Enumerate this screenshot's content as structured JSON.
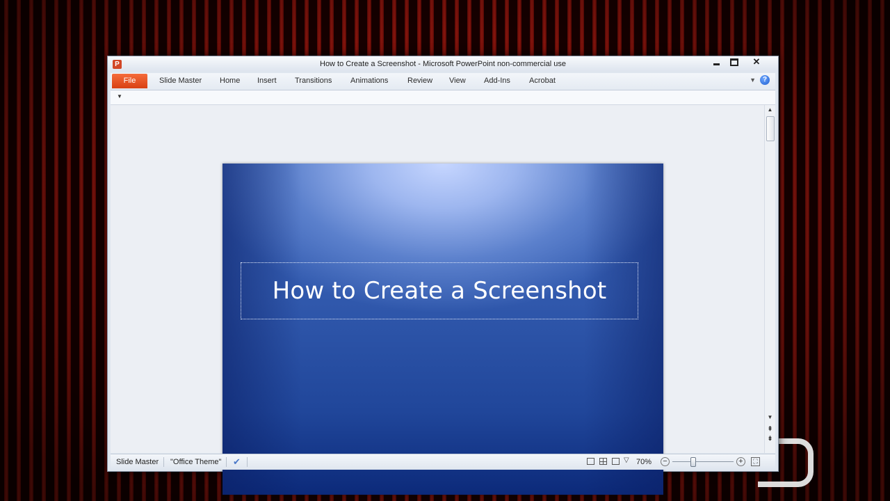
{
  "window": {
    "title": "How to Create a Screenshot  -  Microsoft PowerPoint non-commercial use",
    "app_icon_letter": "P",
    "close_glyph": "✕"
  },
  "ribbon": {
    "tabs": [
      {
        "label": "File"
      },
      {
        "label": "Slide Master"
      },
      {
        "label": "Home"
      },
      {
        "label": "Insert"
      },
      {
        "label": "Transitions"
      },
      {
        "label": "Animations"
      },
      {
        "label": "Review"
      },
      {
        "label": "View"
      },
      {
        "label": "Add-Ins"
      },
      {
        "label": "Acrobat"
      }
    ],
    "help_glyph": "?"
  },
  "slide": {
    "title": "How to Create a Screenshot"
  },
  "statusbar": {
    "view_name": "Slide Master",
    "theme": "\"Office Theme\"",
    "zoom": "70%",
    "zoom_level_percent": 70
  },
  "icons": {
    "qat_customize": "qat-customize-icon",
    "spell_check": "spell-check-icon",
    "help": "help-icon"
  },
  "colors": {
    "file_tab": "#e8521f",
    "slide_top": "#c6d6ff",
    "slide_bottom": "#0c2a7a"
  }
}
